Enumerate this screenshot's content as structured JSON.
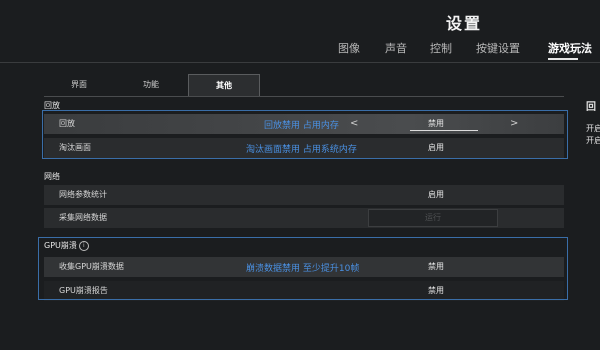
{
  "title": "设置",
  "top_tabs": [
    {
      "label": "图像"
    },
    {
      "label": "声音"
    },
    {
      "label": "控制"
    },
    {
      "label": "按键设置"
    },
    {
      "label": "游戏玩法"
    }
  ],
  "active_top_tab": "游戏玩法",
  "sub_tabs": [
    {
      "label": "界面"
    },
    {
      "label": "功能"
    },
    {
      "label": "其他"
    }
  ],
  "active_sub_tab": "其他",
  "sections": {
    "replay": {
      "label": "回放",
      "rows": [
        {
          "label": "回放",
          "value": "禁用"
        },
        {
          "label": "淘汰画面",
          "value": "启用"
        }
      ]
    },
    "network": {
      "label": "网络",
      "rows": [
        {
          "label": "网络参数统计",
          "value": "启用"
        },
        {
          "label": "采集网络数据",
          "button": "运行"
        }
      ]
    },
    "gpu": {
      "label": "GPU崩溃",
      "info_icon": "info-icon",
      "rows": [
        {
          "label": "收集GPU崩溃数据",
          "value": "禁用"
        },
        {
          "label": "GPU崩溃报告",
          "value": "禁用"
        }
      ]
    }
  },
  "annotations": {
    "replay": "回放禁用 占用内存",
    "elimination": "淘汰画面禁用 占用系统内存",
    "gpu": "崩溃数据禁用 至少提升10帧"
  },
  "right_panel": {
    "title": "回",
    "lines": [
      "开启",
      "开启"
    ]
  },
  "colors": {
    "background": "#1b1d1f",
    "row": "#2a2c2e",
    "annotation": "#4a90e2",
    "annotation_box": "#3a6ea8"
  }
}
